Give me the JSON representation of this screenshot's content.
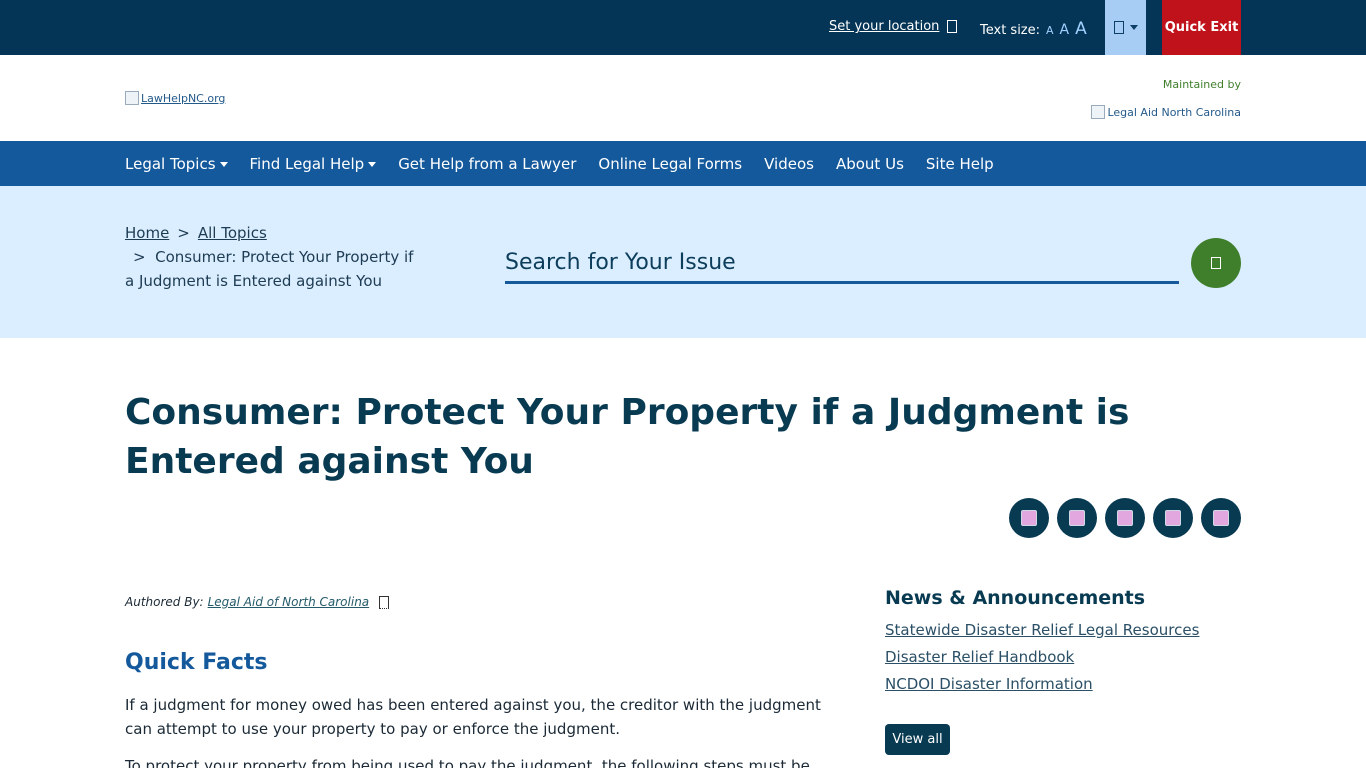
{
  "utility_bar": {
    "location_label": "Set your location",
    "text_size_label": "Text size:",
    "text_size_small": "A",
    "text_size_medium": "A",
    "text_size_large": "A",
    "quick_exit_label": "Quick Exit"
  },
  "header": {
    "logo_alt": "LawHelpNC.org",
    "maintained_by": "Maintained by",
    "partner_logo_alt": "Legal Aid North Carolina"
  },
  "nav": {
    "items": [
      {
        "label": "Legal Topics",
        "has_dropdown": true
      },
      {
        "label": "Find Legal Help",
        "has_dropdown": true
      },
      {
        "label": "Get Help from a Lawyer",
        "has_dropdown": false
      },
      {
        "label": "Online Legal Forms",
        "has_dropdown": false
      },
      {
        "label": "Videos",
        "has_dropdown": false
      },
      {
        "label": "About Us",
        "has_dropdown": false
      },
      {
        "label": "Site Help",
        "has_dropdown": false
      }
    ]
  },
  "breadcrumb": {
    "home": "Home",
    "separator": ">",
    "all_topics": "All Topics",
    "current": "Consumer: Protect Your Property if a Judgment is Entered against You"
  },
  "search": {
    "placeholder": "Search for Your Issue"
  },
  "page": {
    "title": "Consumer: Protect Your Property if a Judgment is Entered against You"
  },
  "share": {
    "icons": [
      "facebook-icon",
      "twitter-icon",
      "linkedin-icon",
      "email-icon",
      "print-icon"
    ]
  },
  "article": {
    "authored_prefix": "Authored By:",
    "author": "Legal Aid of North Carolina",
    "quick_facts_heading": "Quick Facts",
    "paragraph_1": "If a judgment for money owed has been entered against you, the creditor with the judgment can attempt to use your property to pay or enforce the judgment.",
    "paragraph_2": "To protect your property from being used to pay the judgment, the following steps must be followed:"
  },
  "sidebar": {
    "news_heading": "News & Announcements",
    "news_items": [
      "Statewide Disaster Relief Legal Resources",
      "Disaster Relief Handbook",
      "NCDOI Disaster Information"
    ],
    "view_all_label": "View all"
  },
  "colors": {
    "utility_bar_bg": "#053556",
    "nav_bg": "#14599c",
    "search_band_bg": "#dbeeff",
    "quick_exit_bg": "#c0121b",
    "search_button_bg": "#3f7f2c",
    "title_color": "#083a52"
  }
}
